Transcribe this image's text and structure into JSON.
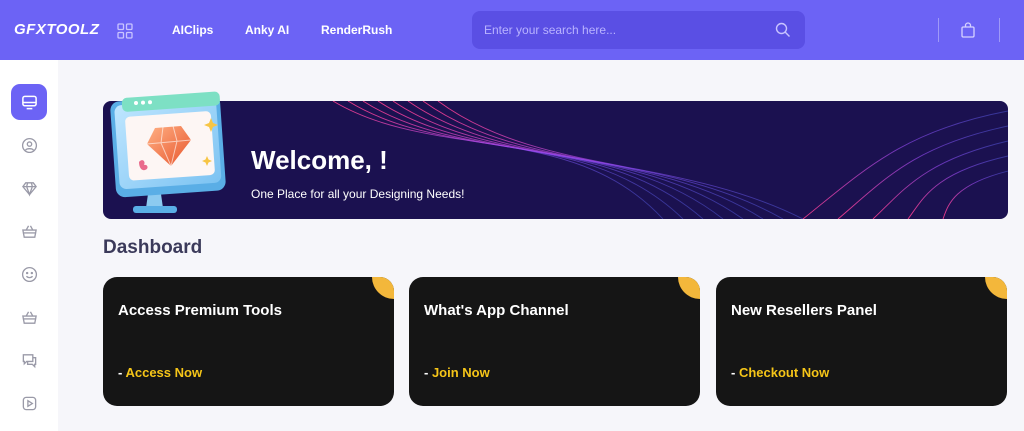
{
  "header": {
    "logo": "GFXTOOLZ",
    "nav": [
      "AIClips",
      "Anky AI",
      "RenderRush"
    ],
    "search_placeholder": "Enter your search here..."
  },
  "sidebar": {
    "items": [
      "monitor-icon",
      "user-circle-icon",
      "diamond-icon",
      "basket-icon",
      "smile-icon",
      "basket-icon",
      "chat-icon",
      "play-icon"
    ]
  },
  "banner": {
    "title": "Welcome, !",
    "subtitle": "One Place for all your Designing Needs!"
  },
  "main": {
    "section_title": "Dashboard",
    "cards": [
      {
        "title": "Access Premium Tools",
        "prefix": "- ",
        "link": "Access Now"
      },
      {
        "title": "What's App Channel",
        "prefix": "- ",
        "link": "Join Now"
      },
      {
        "title": "New Resellers Panel",
        "prefix": "- ",
        "link": "Checkout Now"
      }
    ]
  },
  "colors": {
    "primary": "#6c63f5",
    "banner_bg": "#1b1150",
    "card_bg": "#151515",
    "link_accent": "#f5c518",
    "corner_accent": "#f3b73b"
  }
}
